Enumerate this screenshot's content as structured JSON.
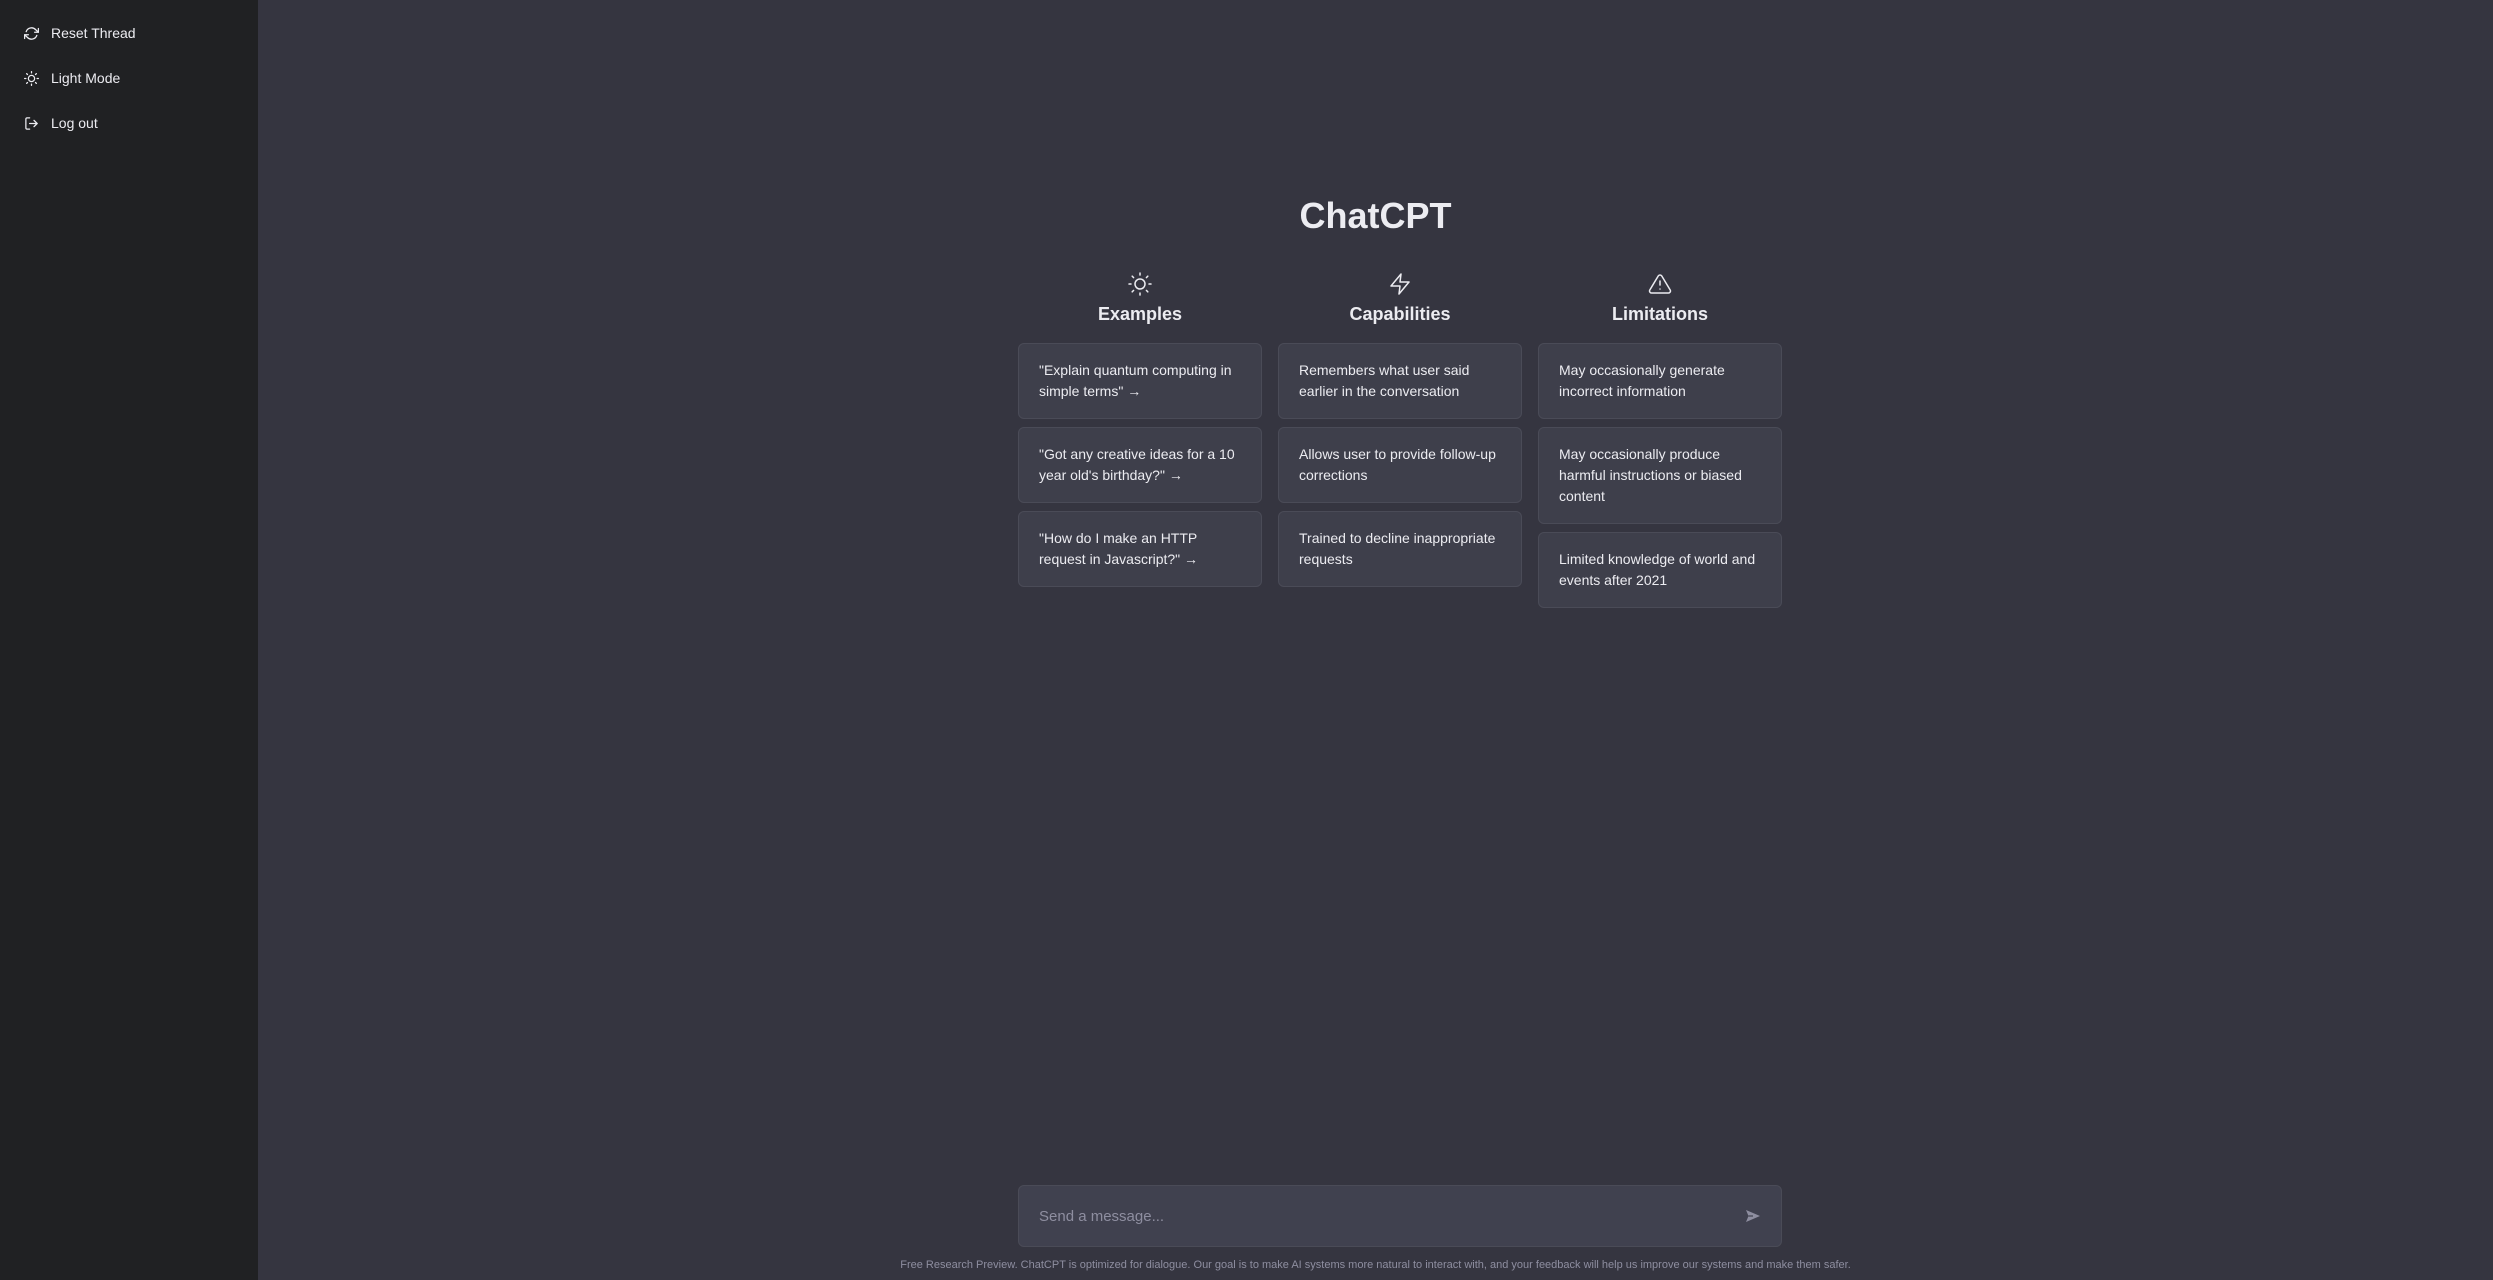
{
  "sidebar": {
    "items": [
      {
        "label": "Reset Thread",
        "icon": "refresh-icon"
      },
      {
        "label": "Light Mode",
        "icon": "sun-icon"
      },
      {
        "label": "Log out",
        "icon": "logout-icon"
      }
    ]
  },
  "main": {
    "title": "ChatCPT",
    "columns": [
      {
        "title": "Examples",
        "icon": "sun-icon",
        "cards": [
          "\"Explain quantum computing in simple terms\" →",
          "\"Got any creative ideas for a 10 year old's birthday?\" →",
          "\"How do I make an HTTP request in Javascript?\" →"
        ]
      },
      {
        "title": "Capabilities",
        "icon": "lightning-icon",
        "cards": [
          "Remembers what user said earlier in the conversation",
          "Allows user to provide follow-up corrections",
          "Trained to decline inappropriate requests"
        ]
      },
      {
        "title": "Limitations",
        "icon": "warning-icon",
        "cards": [
          "May occasionally generate incorrect information",
          "May occasionally produce harmful instructions or biased content",
          "Limited knowledge of world and events after 2021"
        ]
      }
    ]
  },
  "composer": {
    "placeholder": "Send a message...",
    "send_icon": "send-icon"
  },
  "footer": {
    "text": "Free Research Preview. ChatCPT is optimized for dialogue. Our goal is to make AI systems more natural to interact with, and your feedback will help us improve our systems and make them safer."
  },
  "colors": {
    "sidebar_bg": "#202123",
    "main_bg": "#353540",
    "card_bg": "#3e3f4b",
    "input_bg": "#40414f",
    "text": "#ececf1",
    "muted": "#8e8ea0"
  }
}
